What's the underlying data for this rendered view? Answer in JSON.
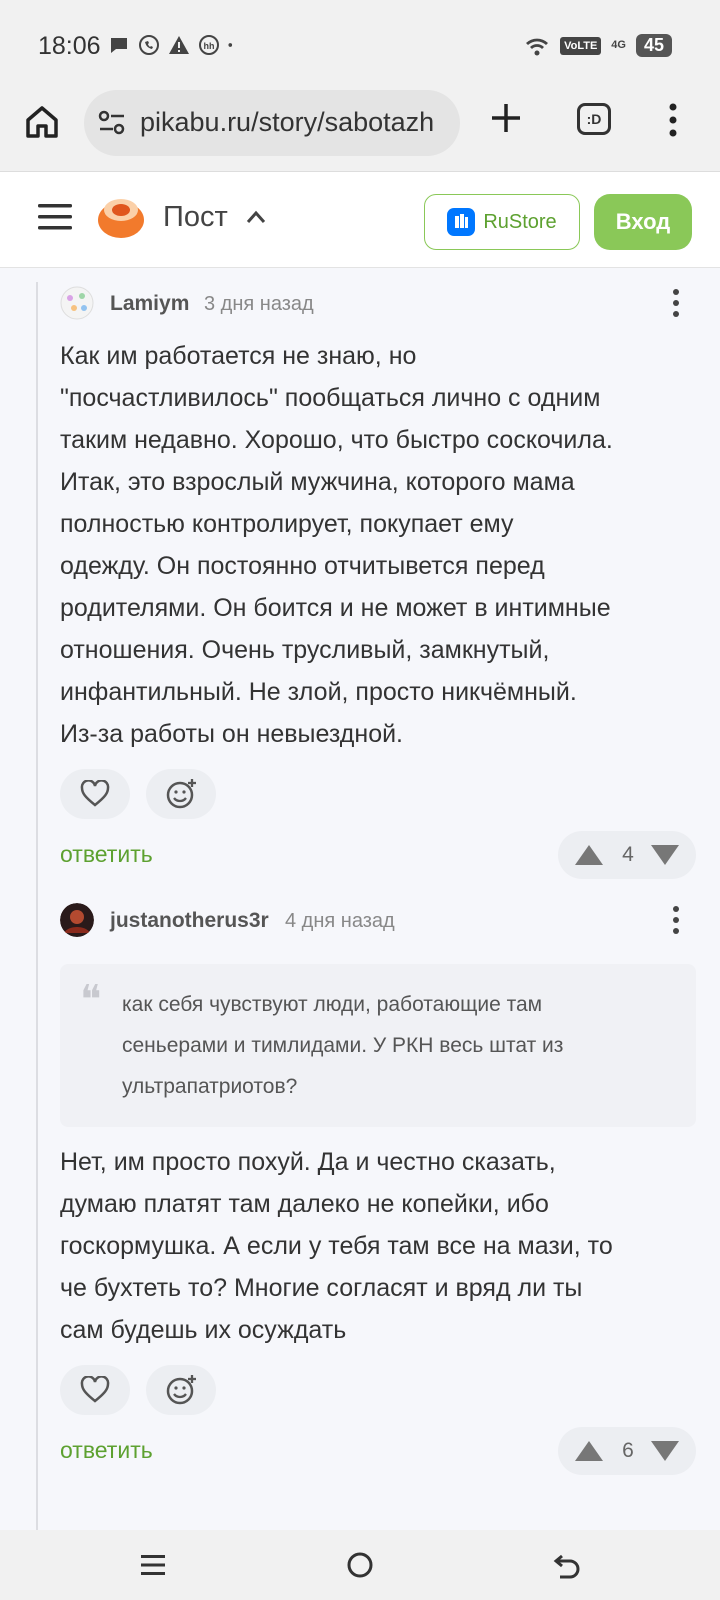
{
  "status_bar": {
    "time": "18:06",
    "volte": "VoLTE",
    "network": "4G",
    "battery": "45"
  },
  "browser": {
    "url": "pikabu.ru/story/sabotazh",
    "tabs_label": ":D"
  },
  "site_header": {
    "title": "Пост",
    "rustore_label": "RuStore",
    "login_label": "Вход"
  },
  "comments": [
    {
      "author": "Lamiym",
      "time": "3 дня назад",
      "lines": [
        "Как им работается не знаю, но",
        "\"посчастливилось\" пообщаться лично с одним",
        "таким недавно. Хорошо, что быстро соскочила.",
        "Итак, это взрослый мужчина, которого мама",
        "полностью контролирует, покупает ему",
        "одежду. Он постоянно отчитывется перед",
        "родителями. Он боится и не может в интимные",
        "отношения. Очень трусливый, замкнутый,",
        "инфантильный. Не злой, просто никчёмный.",
        "Из-за работы он невыездной."
      ],
      "reply_label": "ответить",
      "rating": "4"
    },
    {
      "author": "justanotherus3r",
      "time": "4 дня назад",
      "quote_lines": [
        "как себя чувствуют люди, работающие там",
        "сеньерами и тимлидами. У РКН весь штат из",
        "ультрапатриотов?"
      ],
      "lines": [
        "Нет, им просто похуй. Да и честно сказать,",
        "думаю платят там далеко не копейки, ибо",
        "госкормушка. А если у тебя там все на мази, то",
        "че бухтеть то? Многие согласят и вряд ли ты",
        "сам будешь их осуждать"
      ],
      "reply_label": "ответить",
      "rating": "6"
    }
  ],
  "colors": {
    "accent_green": "#8ac858",
    "link_green": "#5da130",
    "rustore_blue": "#0077ff",
    "logo_orange": "#f27a2c"
  }
}
